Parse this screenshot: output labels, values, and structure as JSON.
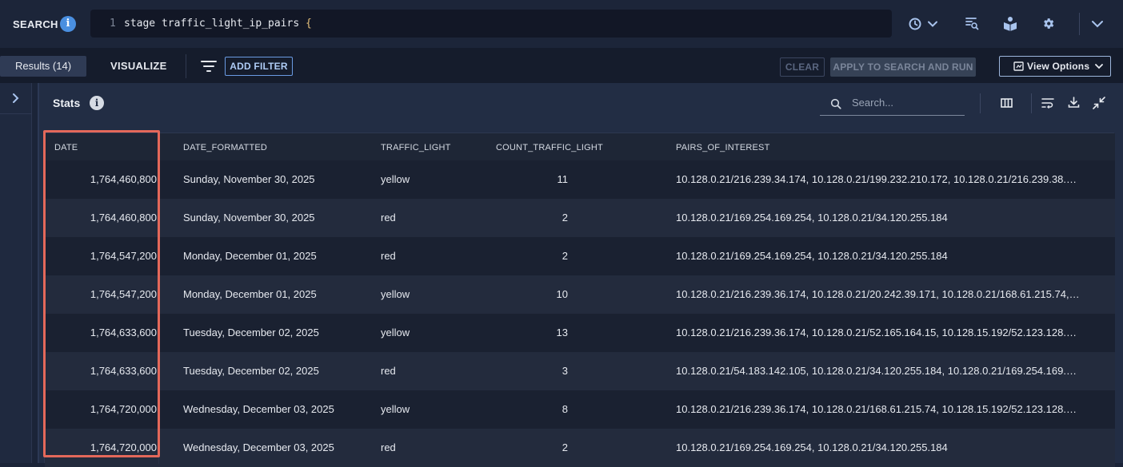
{
  "topbar": {
    "search_label": "SEARCH",
    "info_glyph": "i",
    "query_line_number": "1",
    "query_text": "stage traffic_light_ip_pairs ",
    "query_brace": "{",
    "icons": [
      "info-icon",
      "history-icon",
      "chevron-down-icon",
      "search-list-icon",
      "book-user-icon",
      "gear-icon",
      "chevron-down-icon"
    ]
  },
  "subbar": {
    "results_tab": "Results (14)",
    "visualize_tab": "VISUALIZE",
    "add_filter": "ADD FILTER",
    "clear": "CLEAR",
    "apply": "APPLY TO SEARCH AND RUN",
    "view_options": "View Options"
  },
  "panel": {
    "title": "Stats",
    "info_glyph": "i",
    "search_placeholder": "Search..."
  },
  "table": {
    "columns": [
      "DATE",
      "DATE_FORMATTED",
      "TRAFFIC_LIGHT",
      "COUNT_TRAFFIC_LIGHT",
      "PAIRS_OF_INTEREST"
    ],
    "rows": [
      {
        "date": "1,764,460,800",
        "date_formatted": "Sunday, November 30, 2025",
        "traffic_light": "yellow",
        "count": "11",
        "pairs": "10.128.0.21/216.239.34.174, 10.128.0.21/199.232.210.172, 10.128.0.21/216.239.38.17…"
      },
      {
        "date": "1,764,460,800",
        "date_formatted": "Sunday, November 30, 2025",
        "traffic_light": "red",
        "count": "2",
        "pairs": "10.128.0.21/169.254.169.254, 10.128.0.21/34.120.255.184"
      },
      {
        "date": "1,764,547,200",
        "date_formatted": "Monday, December 01, 2025",
        "traffic_light": "red",
        "count": "2",
        "pairs": "10.128.0.21/169.254.169.254, 10.128.0.21/34.120.255.184"
      },
      {
        "date": "1,764,547,200",
        "date_formatted": "Monday, December 01, 2025",
        "traffic_light": "yellow",
        "count": "10",
        "pairs": "10.128.0.21/216.239.36.174, 10.128.0.21/20.242.39.171, 10.128.0.21/168.61.215.74, 1…"
      },
      {
        "date": "1,764,633,600",
        "date_formatted": "Tuesday, December 02, 2025",
        "traffic_light": "yellow",
        "count": "13",
        "pairs": "10.128.0.21/216.239.36.174, 10.128.0.21/52.165.164.15, 10.128.15.192/52.123.128.14,…"
      },
      {
        "date": "1,764,633,600",
        "date_formatted": "Tuesday, December 02, 2025",
        "traffic_light": "red",
        "count": "3",
        "pairs": "10.128.0.21/54.183.142.105, 10.128.0.21/34.120.255.184, 10.128.0.21/169.254.169.254"
      },
      {
        "date": "1,764,720,000",
        "date_formatted": "Wednesday, December 03, 2025",
        "traffic_light": "yellow",
        "count": "8",
        "pairs": "10.128.0.21/216.239.36.174, 10.128.0.21/168.61.215.74, 10.128.15.192/52.123.128.14,…"
      },
      {
        "date": "1,764,720,000",
        "date_formatted": "Wednesday, December 03, 2025",
        "traffic_light": "red",
        "count": "2",
        "pairs": "10.128.0.21/169.254.169.254, 10.128.0.21/34.120.255.184"
      }
    ]
  },
  "colors": {
    "accent": "#4a8fe0",
    "highlight_box": "#e4685a",
    "background": "#1b2438"
  }
}
